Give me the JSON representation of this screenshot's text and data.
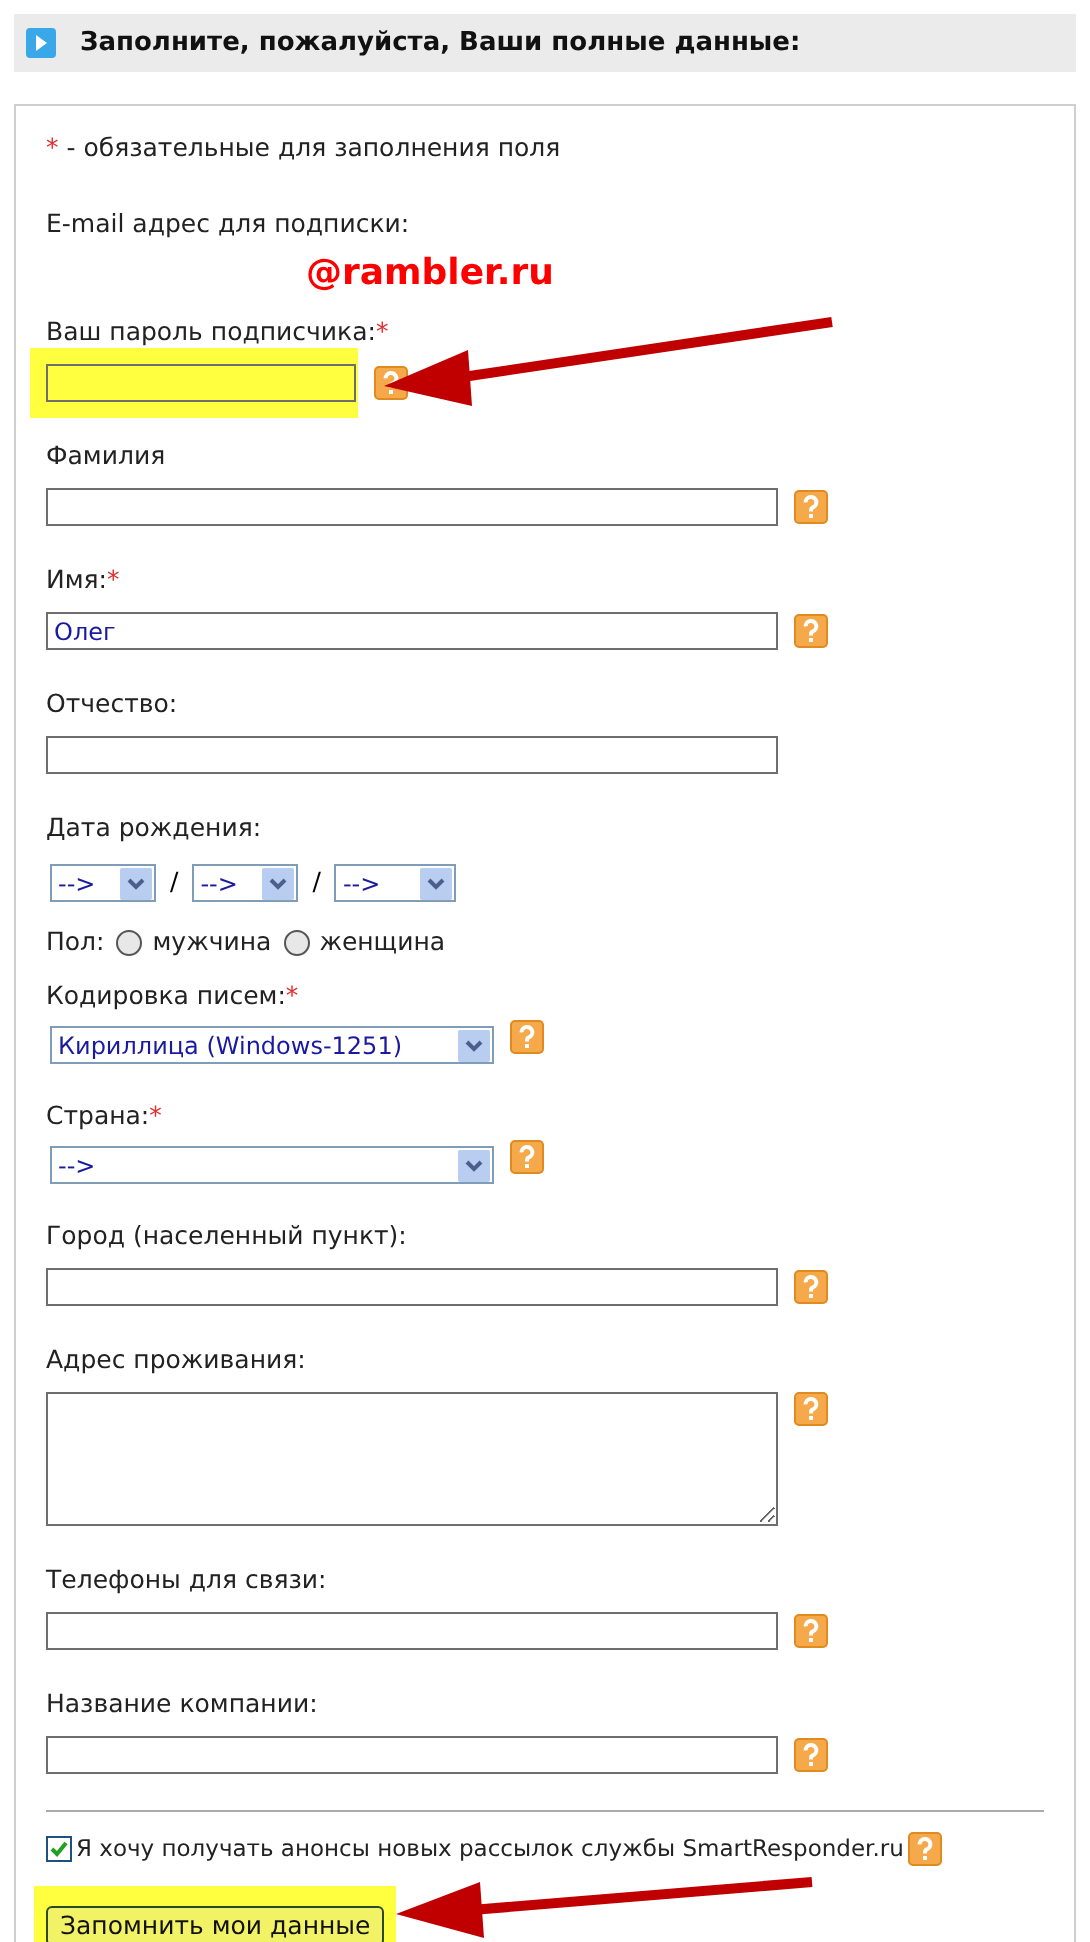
{
  "header": {
    "title": "Заполните, пожалуйста, Ваши полные данные:"
  },
  "required_mark": "*",
  "required_note": "- обязательные для заполнения поля",
  "fields": [
    {
      "kind": "email",
      "label": "E-mail адрес для подписки:",
      "value": "@rambler.ru"
    },
    {
      "kind": "password",
      "label": "Ваш пароль подписчика:",
      "required": true,
      "help": true,
      "highlighted": true
    },
    {
      "kind": "text",
      "label": "Фамилия",
      "required": false,
      "help": true
    },
    {
      "kind": "text",
      "label": "Имя:",
      "value": "Олег",
      "required": true,
      "help": true
    },
    {
      "kind": "text",
      "label": "Отчество:",
      "required": false,
      "help": false
    },
    {
      "kind": "date",
      "label": "Дата рождения:",
      "separator": "/",
      "selects": [
        {
          "value": "-->"
        },
        {
          "value": "-->"
        },
        {
          "value": "-->"
        }
      ]
    },
    {
      "kind": "radio",
      "label": "Пол:",
      "options": [
        {
          "label": "мужчина",
          "selected": false
        },
        {
          "label": "женщина",
          "selected": false
        }
      ]
    },
    {
      "kind": "select",
      "label": "Кодировка писем:",
      "value": "Кириллица (Windows-1251)",
      "required": true,
      "help": true
    },
    {
      "kind": "select",
      "label": "Страна:",
      "value": "-->",
      "required": true,
      "help": true
    },
    {
      "kind": "text",
      "label": "Город (населенный пункт):",
      "required": false,
      "help": true
    },
    {
      "kind": "textarea",
      "label": "Адрес проживания:",
      "required": false,
      "help": true
    },
    {
      "kind": "text",
      "label": "Телефоны для связи:",
      "required": false,
      "help": true
    },
    {
      "kind": "text",
      "label": "Название компании:",
      "required": false,
      "help": true
    }
  ],
  "subscribe": {
    "label": "Я хочу получать анонсы новых рассылок службы SmartResponder.ru",
    "checked": true,
    "help": true
  },
  "submit": {
    "label": "Запомнить мои данные",
    "highlighted": true
  }
}
